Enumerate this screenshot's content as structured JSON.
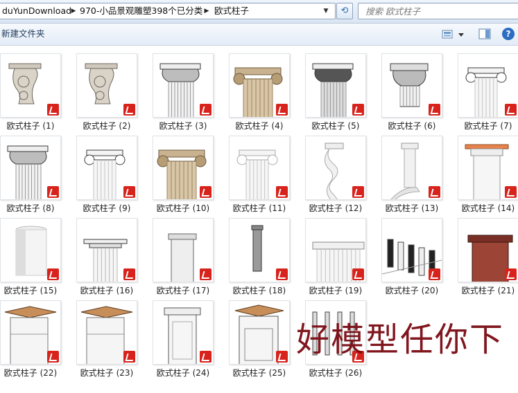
{
  "address": {
    "crumbs": [
      "duYunDownload",
      "970-小品景观雕塑398个已分类",
      "欧式柱子"
    ]
  },
  "search": {
    "placeholder": "搜索 欧式柱子"
  },
  "toolbar": {
    "new_folder_label": "新建文件夹"
  },
  "files": [
    {
      "name": "欧式柱子 (1)",
      "style": "corbel"
    },
    {
      "name": "欧式柱子 (2)",
      "style": "corbel"
    },
    {
      "name": "欧式柱子 (3)",
      "style": "corinthian"
    },
    {
      "name": "欧式柱子 (4)",
      "style": "ionic-stone"
    },
    {
      "name": "欧式柱子 (5)",
      "style": "corinthian-dark"
    },
    {
      "name": "欧式柱子 (6)",
      "style": "corinthian-cap"
    },
    {
      "name": "欧式柱子 (7)",
      "style": "ionic"
    },
    {
      "name": "欧式柱子 (8)",
      "style": "corinthian"
    },
    {
      "name": "欧式柱子 (9)",
      "style": "ionic"
    },
    {
      "name": "欧式柱子 (10)",
      "style": "ionic-stone"
    },
    {
      "name": "欧式柱子 (11)",
      "style": "ionic-white"
    },
    {
      "name": "欧式柱子 (12)",
      "style": "twisted"
    },
    {
      "name": "欧式柱子 (13)",
      "style": "twisted-curve"
    },
    {
      "name": "欧式柱子 (14)",
      "style": "doric-orange"
    },
    {
      "name": "欧式柱子 (15)",
      "style": "plain-shaded"
    },
    {
      "name": "欧式柱子 (16)",
      "style": "doric"
    },
    {
      "name": "欧式柱子 (17)",
      "style": "doric-tall"
    },
    {
      "name": "欧式柱子 (18)",
      "style": "slim-dark"
    },
    {
      "name": "欧式柱子 (19)",
      "style": "base"
    },
    {
      "name": "欧式柱子 (20)",
      "style": "row"
    },
    {
      "name": "欧式柱子 (21)",
      "style": "brick"
    },
    {
      "name": "欧式柱子 (22)",
      "style": "square-wood"
    },
    {
      "name": "欧式柱子 (23)",
      "style": "square-wood"
    },
    {
      "name": "欧式柱子 (24)",
      "style": "square"
    },
    {
      "name": "欧式柱子 (25)",
      "style": "square-panel"
    },
    {
      "name": "欧式柱子 (26)",
      "style": "group"
    }
  ],
  "watermark": {
    "text": "好模型任你下"
  }
}
